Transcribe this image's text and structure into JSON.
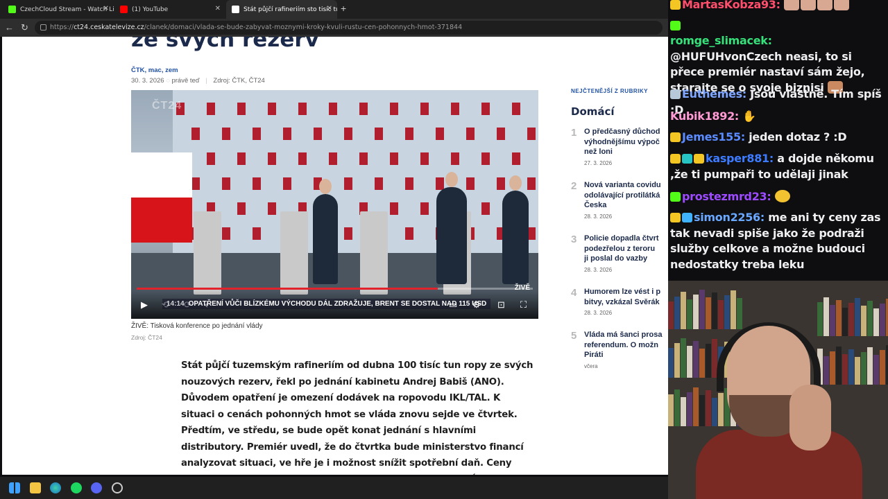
{
  "browser": {
    "tabs": [
      {
        "title": "CzechCloud Stream - Watch Live o",
        "favicon_color": "#53fc18"
      },
      {
        "title": "(1) YouTube",
        "favicon_color": "#ff0000"
      },
      {
        "title": "Stát půjčí rafineriím sto tisíc tun",
        "favicon_color": "#ffffff",
        "active": true
      }
    ],
    "url_prefix": "https://",
    "url_domain": "ct24.ceskatelevize.cz",
    "url_path": "/clanek/domaci/vlada-se-bude-zabyvat-moznymi-kroky-kvuli-rustu-cen-pohonnych-hmot-371844"
  },
  "article": {
    "headline_fragment": "ze svých rezerv",
    "authors": "ČTK, mac, zem",
    "date": "30. 3. 2026",
    "time": "právě teď",
    "source_label": "Zdroj: ČTK, ČT24",
    "video": {
      "live_label": "ŽIVĚ",
      "timecode": "14:14",
      "ticker": "OPATŘENÍ VŮČI BLÍZKÉMU VÝCHODU DÁL ZDRAŽUJE, BRENT SE DOSTAL NAD 115 USD",
      "progress": 0.76,
      "channel_logo": "ČT24"
    },
    "caption": "ŽIVĚ: Tisková konference po jednání vlády",
    "caption_source": "Zdroj: ČT24",
    "lead": "Stát půjčí tuzemským rafineriím od dubna 100 tisíc tun ropy ze svých nouzových rezerv, řekl po jednání kabinetu Andrej Babiš (ANO). Důvodem opatření je omezení dodávek na ropovodu IKL/TAL. K situaci o cenách pohonných hmot se vláda znovu sejde ve čtvrtek. Předtím, ve středu, se bude opět konat jednání s hlavními distributory. Premiér uvedl, že do čtvrtka bude ministerstvo financí analyzovat situaci, ve hře je i možnost snížit spotřební daň. Ceny paliv rychle rostou od konce února, kdy vypukl konflikt v Íránu."
  },
  "sidebar": {
    "kicker": "NEJČTENĚJŠÍ Z RUBRIKY",
    "title": "Domácí",
    "items": [
      {
        "num": "1",
        "text": "O předčasný důchod\nvýhodnějšímu výpoč\nnež loni",
        "date": "27. 3. 2026"
      },
      {
        "num": "2",
        "text": "Nová varianta covidu\nodolávající protilátká\nČeska",
        "date": "28. 3. 2026"
      },
      {
        "num": "3",
        "text": "Policie dopadla čtvrt\npodezřelou z teroru\nji poslal do vazby",
        "date": "28. 3. 2026"
      },
      {
        "num": "4",
        "text": "Humorem lze vést i p\nbitvy, vzkázal Svěrák",
        "date": "28. 3. 2026"
      },
      {
        "num": "5",
        "text": "Vláda má šanci prosa\nreferendum. O možn\nPiráti",
        "date": "včera"
      }
    ]
  },
  "chat": {
    "messages": [
      {
        "user": "MartasKobza93",
        "color": "#ff4f6d",
        "text": ""
      },
      {
        "user": "romge_slimacek",
        "color": "#36e07a",
        "text": "@HUFUHvonCzech neasi, to si přece premiér nastaví sám žejo, starajte se o svoje biznisi"
      },
      {
        "user": "Euthemes",
        "color": "#7fa6ff",
        "text": "Jsou vlastně. Tím spíš :D"
      },
      {
        "user": "Kubik1892",
        "color": "#ff9ad5",
        "text": ""
      },
      {
        "user": "Jemes155",
        "color": "#5b8cff",
        "text": "jeden dotaz ? :D"
      },
      {
        "user": "kasper881",
        "color": "#3d7bff",
        "text": "a dojde někomu ,že ti pumpaři to udělaji jinak"
      },
      {
        "user": "prostezmrd23",
        "color": "#9c4bff",
        "text": ""
      },
      {
        "user": "simon2256",
        "color": "#6aa8ff",
        "text": "me ani ty ceny zas tak nevadi spiše jako že podraži služby celkove a možne budouci nedostatky treba leku"
      }
    ]
  }
}
